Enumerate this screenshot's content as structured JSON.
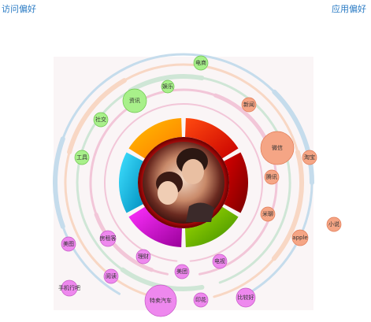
{
  "header": {
    "left_link": "访问偏好",
    "right_link": "应用偏好"
  },
  "colors": {
    "green_tag": "#a8f08a",
    "salmon_tag": "#f5a585",
    "pink_tag": "#ee88ee",
    "ring_blue": "#c5dcec",
    "ring_peach": "#f8d7c4",
    "ring_green": "#cfe6d6",
    "ring_pink": "#f2c6d8",
    "panel_bg": "#faf5f6"
  },
  "donut_segments": [
    {
      "name": "orange-segment",
      "colors": [
        "#ffc000",
        "#ff7a00"
      ]
    },
    {
      "name": "red-segment",
      "colors": [
        "#ff4a10",
        "#c80000"
      ]
    },
    {
      "name": "darkred-segment",
      "colors": [
        "#d80000",
        "#7a0000"
      ]
    },
    {
      "name": "green-segment",
      "colors": [
        "#a6e000",
        "#3a8a00"
      ]
    },
    {
      "name": "purple-segment",
      "colors": [
        "#ff30ff",
        "#9a009a"
      ]
    },
    {
      "name": "cyan-segment",
      "colors": [
        "#40e0ff",
        "#0090c0"
      ]
    }
  ],
  "tags": [
    {
      "label": "电商",
      "color": "green"
    },
    {
      "label": "娱乐",
      "color": "green"
    },
    {
      "label": "资讯",
      "color": "green"
    },
    {
      "label": "社交",
      "color": "green"
    },
    {
      "label": "工具",
      "color": "green"
    },
    {
      "label": "新闻",
      "color": "salmon"
    },
    {
      "label": "微信",
      "color": "salmon"
    },
    {
      "label": "淘宝",
      "color": "salmon"
    },
    {
      "label": "腾讯",
      "color": "salmon"
    },
    {
      "label": "米聊",
      "color": "salmon"
    },
    {
      "label": "apple",
      "color": "salmon"
    },
    {
      "label": "小说",
      "color": "salmon"
    },
    {
      "label": "美图",
      "color": "pink"
    },
    {
      "label": "房租客",
      "color": "pink"
    },
    {
      "label": "理财",
      "color": "pink"
    },
    {
      "label": "电视",
      "color": "pink"
    },
    {
      "label": "美团",
      "color": "pink"
    },
    {
      "label": "阅读",
      "color": "pink"
    },
    {
      "label": "手机行吧",
      "color": "pink"
    },
    {
      "label": "特卖汽车",
      "color": "pink"
    },
    {
      "label": "印花",
      "color": "pink"
    },
    {
      "label": "比较好",
      "color": "pink"
    }
  ]
}
